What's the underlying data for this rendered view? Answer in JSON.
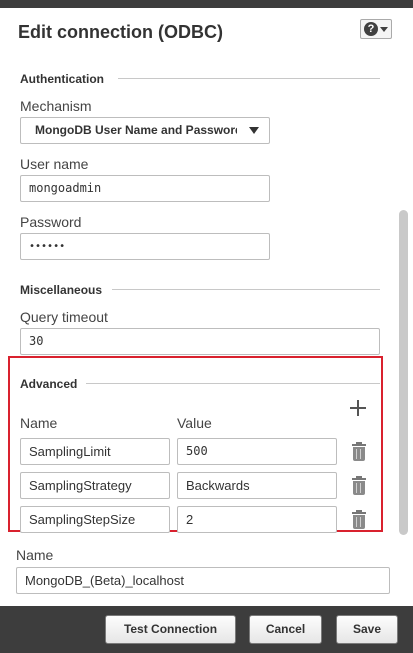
{
  "dialog": {
    "title": "Edit connection (ODBC)",
    "help_glyph": "?"
  },
  "authentication": {
    "section_label": "Authentication",
    "mechanism_label": "Mechanism",
    "mechanism_value": "MongoDB User Name and Password",
    "username_label": "User name",
    "username_value": "mongoadmin",
    "password_label": "Password",
    "password_value": "••••••"
  },
  "miscellaneous": {
    "section_label": "Miscellaneous",
    "query_timeout_label": "Query timeout",
    "query_timeout_value": "30"
  },
  "advanced": {
    "section_label": "Advanced",
    "name_header": "Name",
    "value_header": "Value",
    "rows": [
      {
        "name": "SamplingLimit",
        "value": "500"
      },
      {
        "name": "SamplingStrategy",
        "value": "Backwards"
      },
      {
        "name": "SamplingStepSize",
        "value": "2"
      }
    ]
  },
  "connection": {
    "name_label": "Name",
    "name_value": "MongoDB_(Beta)_localhost"
  },
  "footer": {
    "test_label": "Test Connection",
    "cancel_label": "Cancel",
    "save_label": "Save"
  },
  "icons": {
    "help": "help-icon",
    "dropdown": "chevron-down-icon",
    "add": "plus-icon",
    "delete": "trash-icon"
  },
  "colors": {
    "highlight_border": "#d9212e",
    "frame_background": "#3d3d3d"
  }
}
